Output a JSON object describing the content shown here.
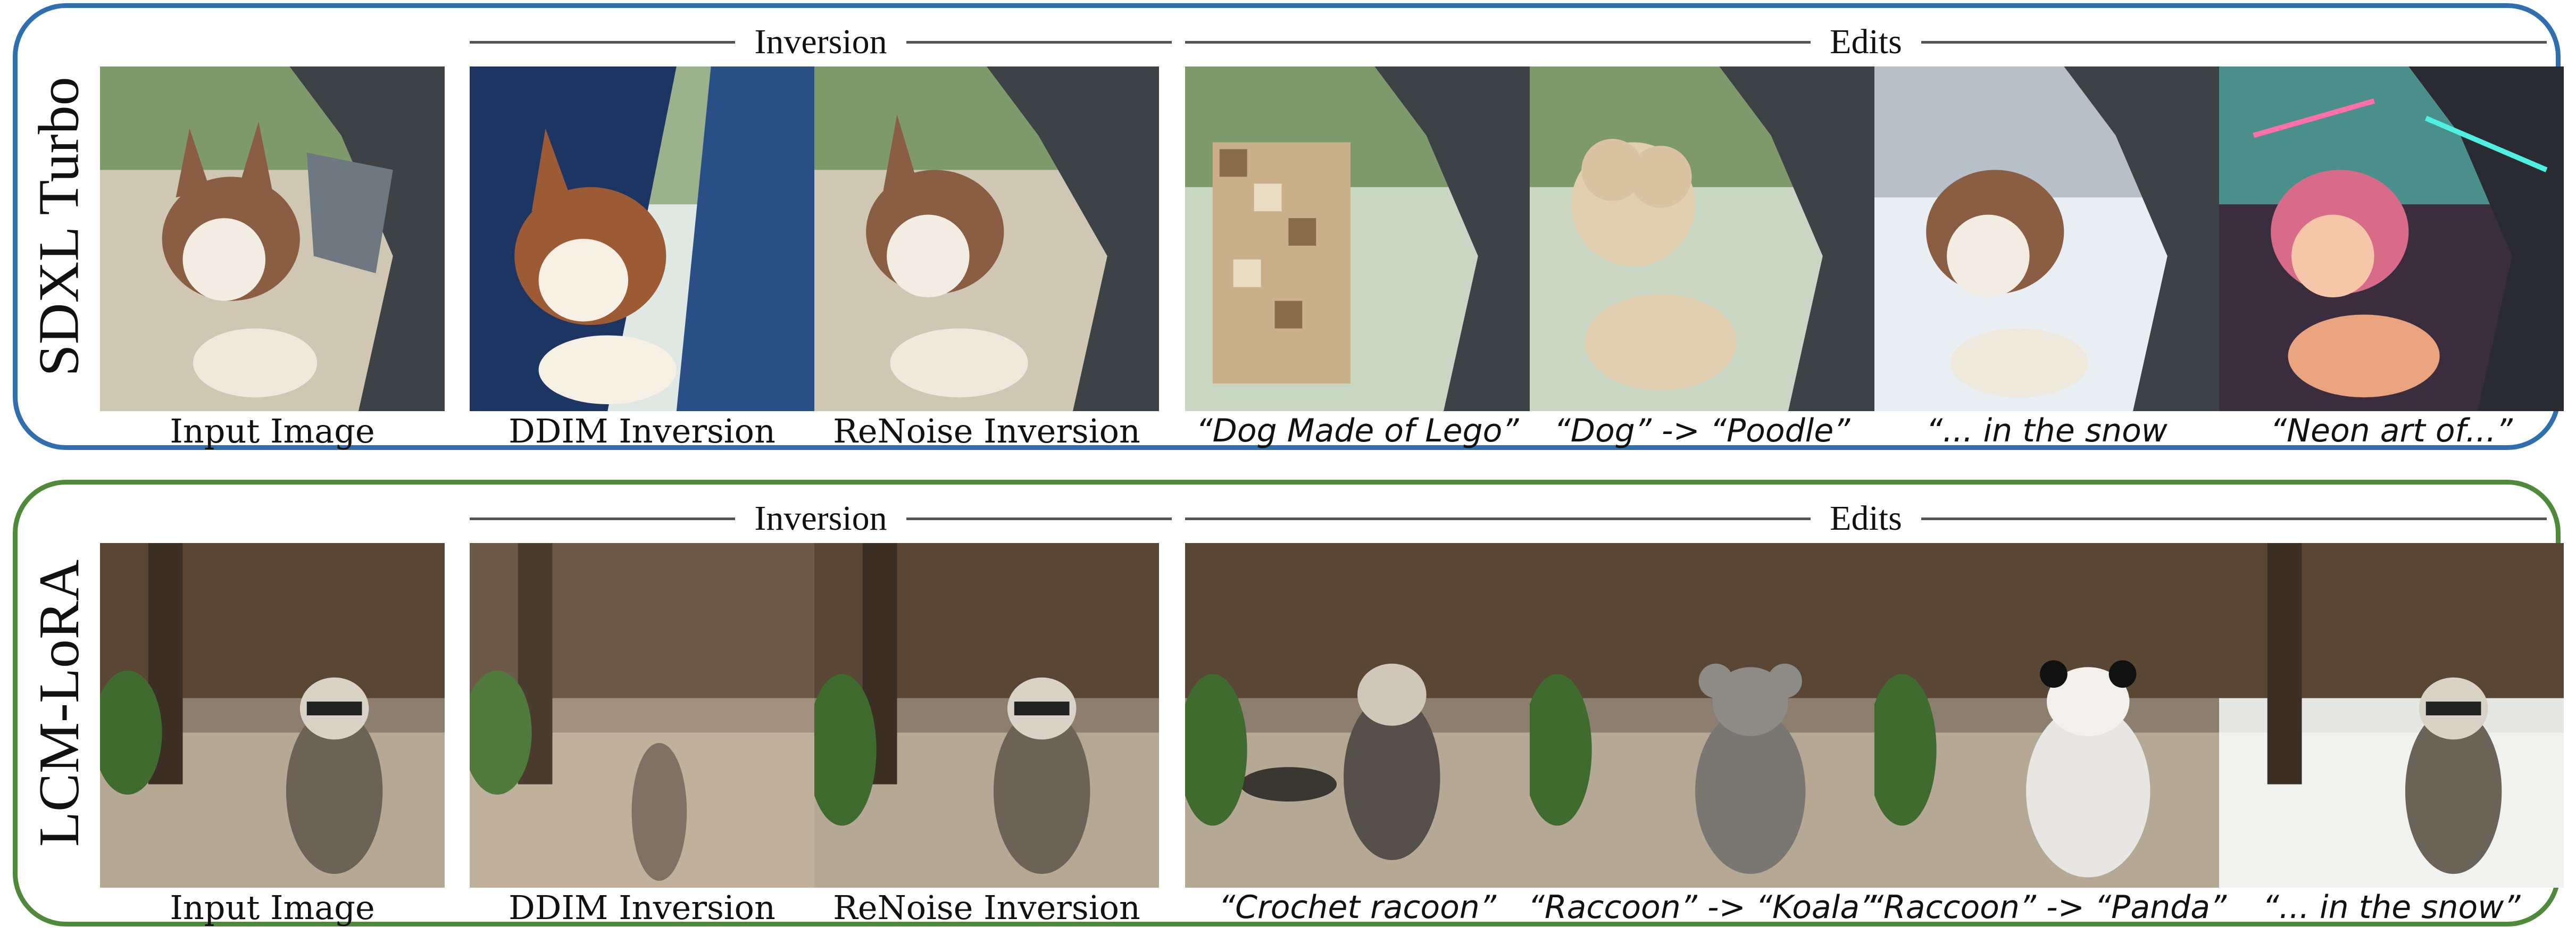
{
  "rows": [
    {
      "model_label": "SDXL Turbo",
      "group_inversion": "Inversion",
      "group_edits": "Edits",
      "captions": [
        "Input Image",
        "DDIM Inversion",
        "ReNoise Inversion",
        "“Dog Made of Lego”",
        "“Dog” -> “Poodle”",
        "“... in the snow",
        "“Neon art of...”"
      ],
      "border_color": "#2f6fb0"
    },
    {
      "model_label": "LCM-LoRA",
      "group_inversion": "Inversion",
      "group_edits": "Edits",
      "captions": [
        "Input Image",
        "DDIM Inversion",
        "ReNoise Inversion",
        "“Crochet racoon”",
        "“Raccoon” -> “Koala”",
        "“Raccoon” -> “Panda”",
        "“... in the snow”"
      ],
      "border_color": "#4f8a3a"
    }
  ]
}
